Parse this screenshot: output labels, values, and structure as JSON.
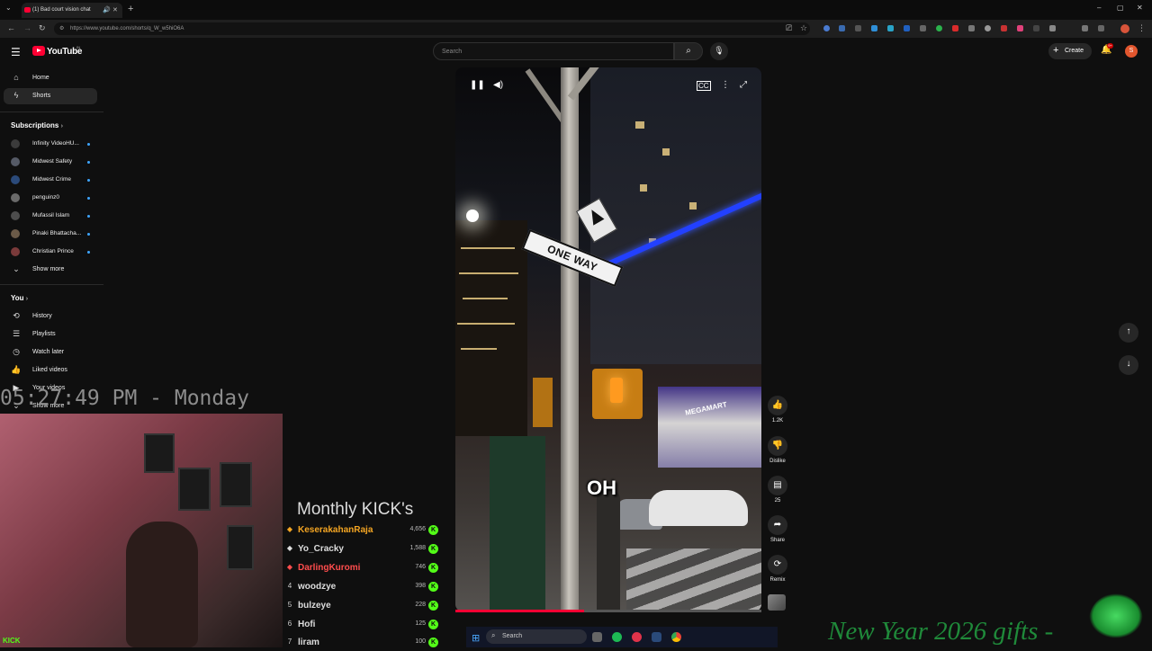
{
  "browser": {
    "tab_title": "(1) Bad court vision chat",
    "url": "https://www.youtube.com/shorts/q_W_w5hiO6A"
  },
  "header": {
    "logo_text": "YouTube",
    "country_code": "IN",
    "search_placeholder": "Search",
    "create_label": "Create",
    "notification_count": "9+",
    "avatar_initial": "S"
  },
  "sidebar": {
    "home": "Home",
    "shorts": "Shorts",
    "subscriptions_title": "Subscriptions",
    "subscriptions": [
      {
        "name": "Infinity VideoHU...",
        "color": "#3b3b3b"
      },
      {
        "name": "Midwest Safety",
        "color": "#555a66"
      },
      {
        "name": "Midwest Crime",
        "color": "#2b4a7a"
      },
      {
        "name": "penguinz0",
        "color": "#6a6a6a"
      },
      {
        "name": "Mufassil Islam",
        "color": "#4d4d4d"
      },
      {
        "name": "Pinaki Bhattacha...",
        "color": "#6b5a48"
      },
      {
        "name": "Christian Prince",
        "color": "#7a3a3a"
      }
    ],
    "show_more": "Show more",
    "you_title": "You",
    "you_items": [
      "History",
      "Playlists",
      "Watch later",
      "Liked videos",
      "Your videos"
    ],
    "show_more_2": "Show more"
  },
  "video": {
    "sign_text": "ONE WAY",
    "storefront_text": "MEGAMART",
    "caption": "OH",
    "progress": 0.42
  },
  "actions": {
    "likes": "1.2K",
    "dislike_label": "Dislike",
    "comments": "25",
    "share_label": "Share",
    "remix_label": "Remix"
  },
  "overlay": {
    "clock": "05:27:49 PM - Monday",
    "kick_logo": "KICK",
    "kick_title": "Monthly KICK's",
    "kick_rows": [
      {
        "rank": "",
        "name": "KeserakahanRaja",
        "value": "4,656",
        "color": "#f5a623"
      },
      {
        "rank": "",
        "name": "Yo_Cracky",
        "value": "1,588",
        "color": "#dddddd"
      },
      {
        "rank": "",
        "name": "DarlingKuromi",
        "value": "746",
        "color": "#ff4d4d"
      },
      {
        "rank": "4",
        "name": "woodzye",
        "value": "398",
        "color": "#dddddd"
      },
      {
        "rank": "5",
        "name": "bulzeye",
        "value": "228",
        "color": "#dddddd"
      },
      {
        "rank": "6",
        "name": "Hofi",
        "value": "125",
        "color": "#dddddd"
      },
      {
        "rank": "7",
        "name": "liram",
        "value": "100",
        "color": "#dddddd"
      }
    ]
  },
  "taskbar": {
    "search_label": "Search"
  },
  "promo": {
    "text": "New Year 2026 gifts -"
  },
  "colors": {
    "yt_red": "#ff0033",
    "kick_green": "#53fc18",
    "promo_green": "#1f8a3a"
  }
}
